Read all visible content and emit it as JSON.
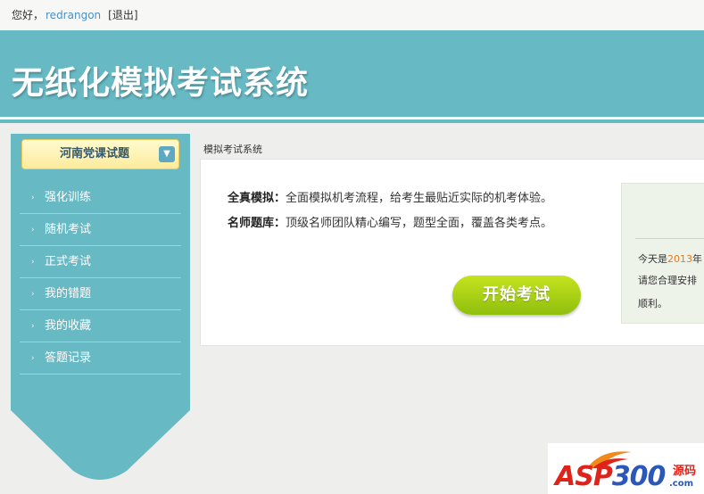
{
  "topbar": {
    "greeting": "您好，",
    "username": "redrangon",
    "logout": "[退出]"
  },
  "header": {
    "title": "无纸化模拟考试系统"
  },
  "sidebar": {
    "subject": "河南党课试题",
    "items": [
      {
        "label": "强化训练"
      },
      {
        "label": "随机考试"
      },
      {
        "label": "正式考试"
      },
      {
        "label": "我的错题"
      },
      {
        "label": "我的收藏"
      },
      {
        "label": "答题记录"
      }
    ]
  },
  "main": {
    "breadcrumb": "模拟考试系统",
    "features": [
      {
        "title": "全真模拟：",
        "text": "全面模拟机考流程，给考生最贴近实际的机考体验。"
      },
      {
        "title": "名师题库：",
        "text": "顶级名师团队精心编写，题型全面，覆盖各类考点。"
      }
    ],
    "start_button": "开始考试"
  },
  "notice": {
    "line1_prefix": "今天是",
    "year": "2013",
    "line1_suffix": "年",
    "line2": "请您合理安排",
    "line3": "顺利。"
  },
  "watermark": {
    "text_a": "ASP",
    "text_b": "300",
    "tag": "源码",
    "domain": ".com"
  },
  "colors": {
    "header_bg": "#67b9c4",
    "sidebar_bg": "#67b9c4",
    "start_button": "#a8d114",
    "year_highlight": "#e27a22"
  }
}
